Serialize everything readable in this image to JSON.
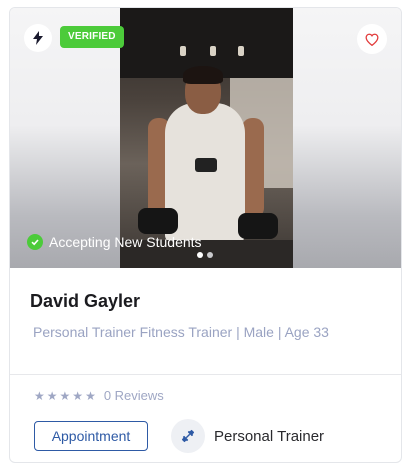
{
  "badges": {
    "verified": "VERIFIED"
  },
  "status": {
    "accepting": "Accepting New Students"
  },
  "trainer": {
    "name": "David Gayler",
    "subtitle": "Personal Trainer Fitness Trainer | Male | Age 33"
  },
  "rating": {
    "stars_filled": 0,
    "stars_total": 5,
    "reviews_label": "0 Reviews"
  },
  "actions": {
    "appointment_label": "Appointment"
  },
  "trainer_type": {
    "label": "Personal Trainer",
    "icon": "dumbbell-icon"
  },
  "carousel": {
    "count": 2,
    "active_index": 0
  },
  "colors": {
    "verified_green": "#4ccb3a",
    "primary_blue": "#2e5aa5",
    "muted_text": "#9aa3c2",
    "heart_red": "#e23b3b"
  },
  "icons": {
    "top_left": "lightning-icon",
    "top_right": "heart-icon",
    "status": "check-circle-icon"
  }
}
